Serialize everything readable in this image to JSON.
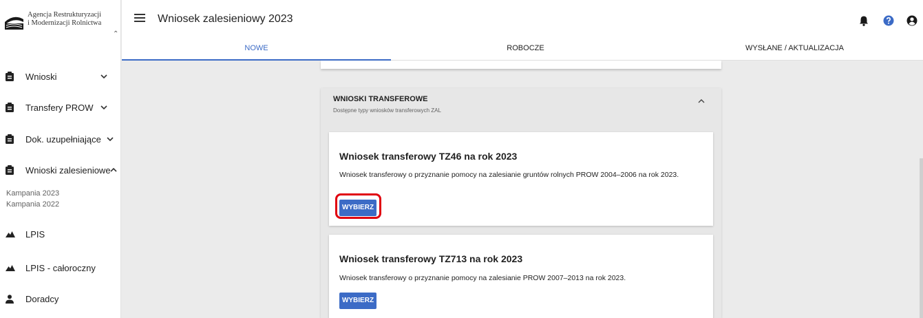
{
  "header": {
    "logo_line1": "Agencja Restrukturyzacji",
    "logo_line2": "i Modernizacji Rolnictwa",
    "title": "Wniosek zalesieniowy 2023"
  },
  "tabs": [
    {
      "label": "NOWE",
      "active": true
    },
    {
      "label": "ROBOCZE",
      "active": false
    },
    {
      "label": "WYSŁANE / AKTUALIZACJA",
      "active": false
    }
  ],
  "sidebar": {
    "items": [
      {
        "label": "Wnioski",
        "icon": "clipboard-icon"
      },
      {
        "label": "Transfery PROW",
        "icon": "clipboard-icon"
      },
      {
        "label": "Dok. uzupełniające",
        "icon": "clipboard-icon"
      },
      {
        "label": "Wnioski zalesieniowe",
        "icon": "clipboard-icon"
      },
      {
        "label": "LPIS",
        "icon": "mountain-icon"
      },
      {
        "label": "LPIS - całoroczny",
        "icon": "mountain-icon"
      },
      {
        "label": "Doradcy",
        "icon": "person-icon"
      }
    ],
    "sub_items": [
      "Kampania 2023",
      "Kampania 2022"
    ]
  },
  "section": {
    "title": "WNIOSKI TRANSFEROWE",
    "subtitle": "Dostępne typy wniosków transferowych ZAL"
  },
  "cards": [
    {
      "title": "Wniosek transferowy TZ46 na rok 2023",
      "description": "Wniosek transferowy o przyznanie pomocy na zalesianie gruntów rolnych PROW 2004–2006 na rok 2023.",
      "button": "WYBIERZ"
    },
    {
      "title": "Wniosek transferowy TZ713 na rok 2023",
      "description": "Wniosek transferowy o przyznanie pomocy na zalesianie PROW 2007–2013 na rok 2023.",
      "button": "WYBIERZ"
    }
  ],
  "colors": {
    "accent": "#3c6bc6",
    "highlight": "#e0000f",
    "background": "#ebebeb"
  }
}
